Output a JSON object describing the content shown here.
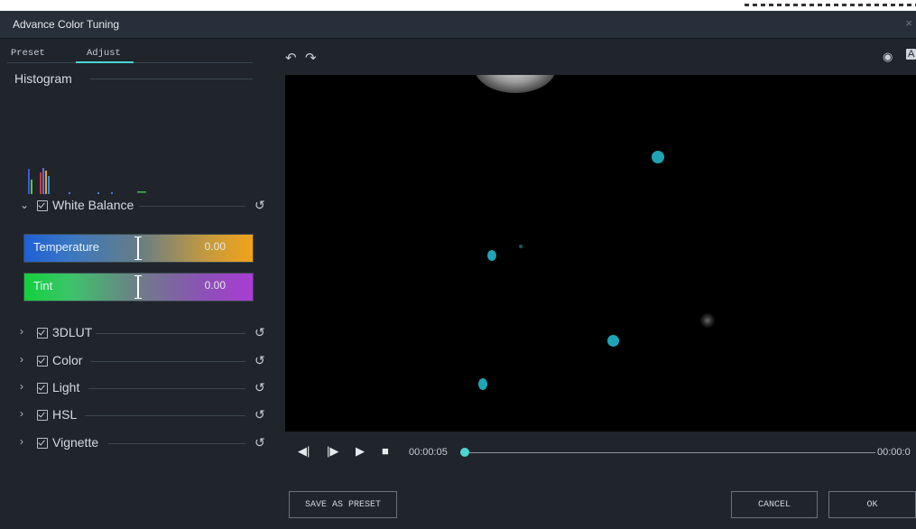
{
  "window": {
    "title": "Advance Color Tuning",
    "close_glyph": "×"
  },
  "tabs": [
    {
      "label": "Preset"
    },
    {
      "label": "Adjust"
    }
  ],
  "histogram": {
    "title": "Histogram"
  },
  "white_balance": {
    "label": "White Balance",
    "temperature": {
      "label": "Temperature",
      "value": "0.00"
    },
    "tint": {
      "label": "Tint",
      "value": "0.00"
    }
  },
  "sections": [
    {
      "label": "3DLUT"
    },
    {
      "label": "Color"
    },
    {
      "label": "Light"
    },
    {
      "label": "HSL"
    },
    {
      "label": "Vignette"
    }
  ],
  "player": {
    "current_time": "00:00:05",
    "end_time": "00:00:0",
    "progress": 0.0
  },
  "buttons": {
    "save_preset": "SAVE AS PRESET",
    "cancel": "CANCEL",
    "ok": "OK"
  },
  "colors": {
    "accent": "#4dd6d1",
    "panel": "#1f252b",
    "titlebar": "#27303a"
  }
}
